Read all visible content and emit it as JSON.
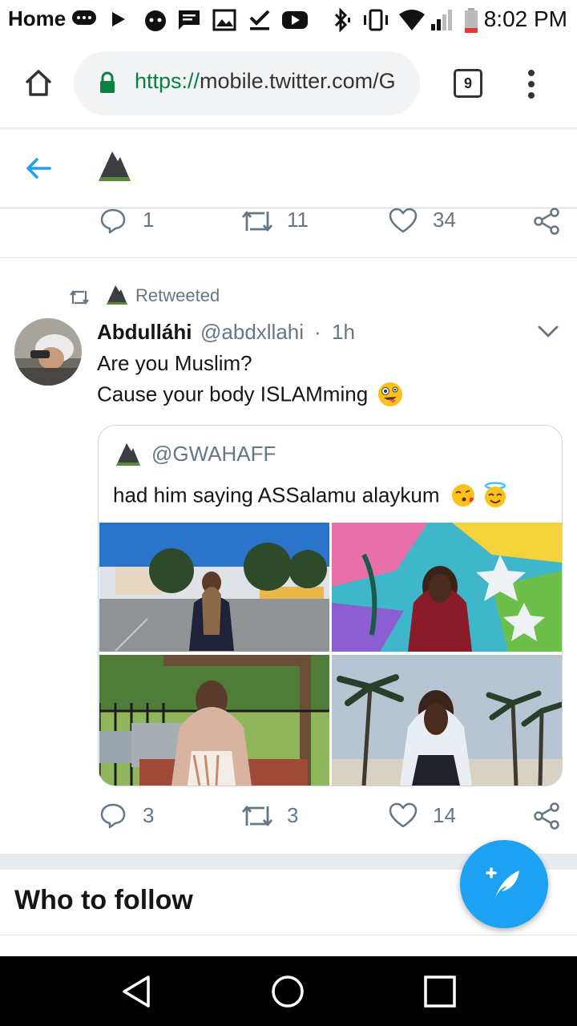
{
  "status_bar": {
    "home_label": "Home",
    "time": "8:02 PM"
  },
  "browser": {
    "url_scheme": "https://",
    "url_rest": "mobile.twitter.com/G",
    "tab_count": "9"
  },
  "prev_tweet_actions": {
    "replies": "1",
    "retweets": "11",
    "likes": "34"
  },
  "tweet": {
    "retweeted_label": "Retweeted",
    "author_name": "Abdulláhi",
    "author_handle": "@abdxllahi",
    "separator": "·",
    "time": "1h",
    "line1": "Are you Muslim?",
    "line2": "Cause your body ISLAMming",
    "quote": {
      "handle": "@GWAHAFF",
      "text": "had him saying ASSalamu alaykum"
    },
    "actions": {
      "replies": "3",
      "retweets": "3",
      "likes": "14"
    }
  },
  "who_to_follow": "Who to follow",
  "colors": {
    "twitter_blue": "#1da1f2",
    "secondary_text": "#657786",
    "lock_green": "#0b8043"
  },
  "icons": [
    "home-icon",
    "lock-icon",
    "kebab-menu-icon",
    "back-arrow-icon",
    "reply-icon",
    "retweet-icon",
    "like-icon",
    "share-icon",
    "chevron-down-icon",
    "compose-icon",
    "nav-back-icon",
    "nav-home-icon",
    "nav-recents-icon"
  ]
}
